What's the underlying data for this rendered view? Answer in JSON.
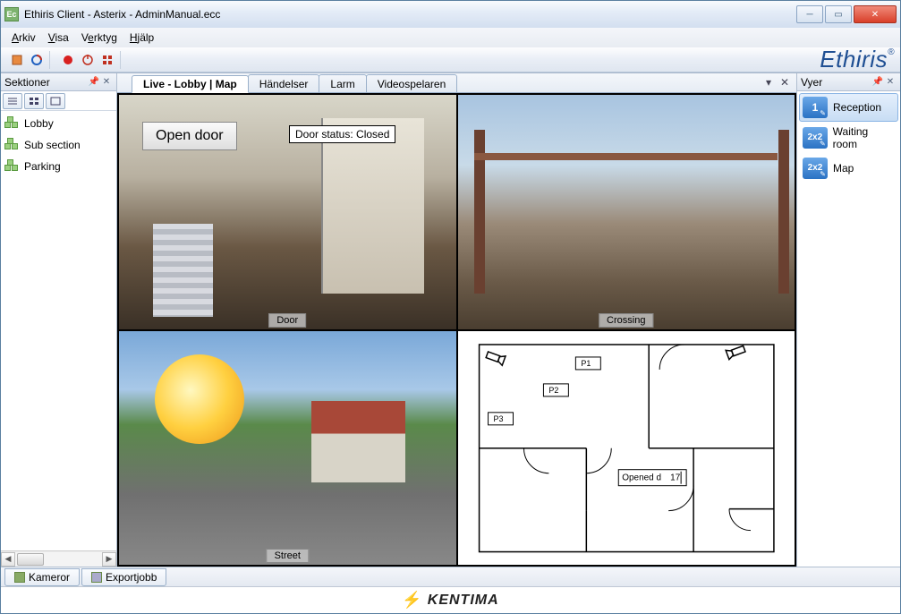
{
  "titlebar": {
    "app_icon_text": "Ec",
    "title": "Ethiris Client - Asterix - AdminManual.ecc"
  },
  "menu": {
    "arkiv": "Arkiv",
    "visa": "Visa",
    "verktyg": "Verktyg",
    "hjalp": "Hjälp"
  },
  "brand": "Ethiris",
  "left_panel": {
    "title": "Sektioner",
    "items": [
      {
        "label": "Lobby"
      },
      {
        "label": "Sub section"
      },
      {
        "label": "Parking"
      }
    ]
  },
  "tabs": {
    "active": "Live - Lobby | Map",
    "others": [
      "Händelser",
      "Larm",
      "Videospelaren"
    ]
  },
  "cells": {
    "door": {
      "name": "Door",
      "open_btn": "Open door",
      "status": "Door status: Closed"
    },
    "crossing": {
      "name": "Crossing"
    },
    "street": {
      "name": "Street"
    },
    "map": {
      "cams": [
        "P1",
        "P2",
        "P3"
      ],
      "opened_label": "Opened d",
      "opened_value": "17"
    }
  },
  "right_panel": {
    "title": "Vyer",
    "items": [
      {
        "badge": "1",
        "label": "Reception",
        "selected": true
      },
      {
        "badge": "2x2",
        "label": "Waiting room",
        "selected": false
      },
      {
        "badge": "2x2",
        "label": "Map",
        "selected": false
      }
    ]
  },
  "bottom_tabs": {
    "kameror": "Kameror",
    "export": "Exportjobb"
  },
  "footer": {
    "brand": "KENTIMA"
  }
}
